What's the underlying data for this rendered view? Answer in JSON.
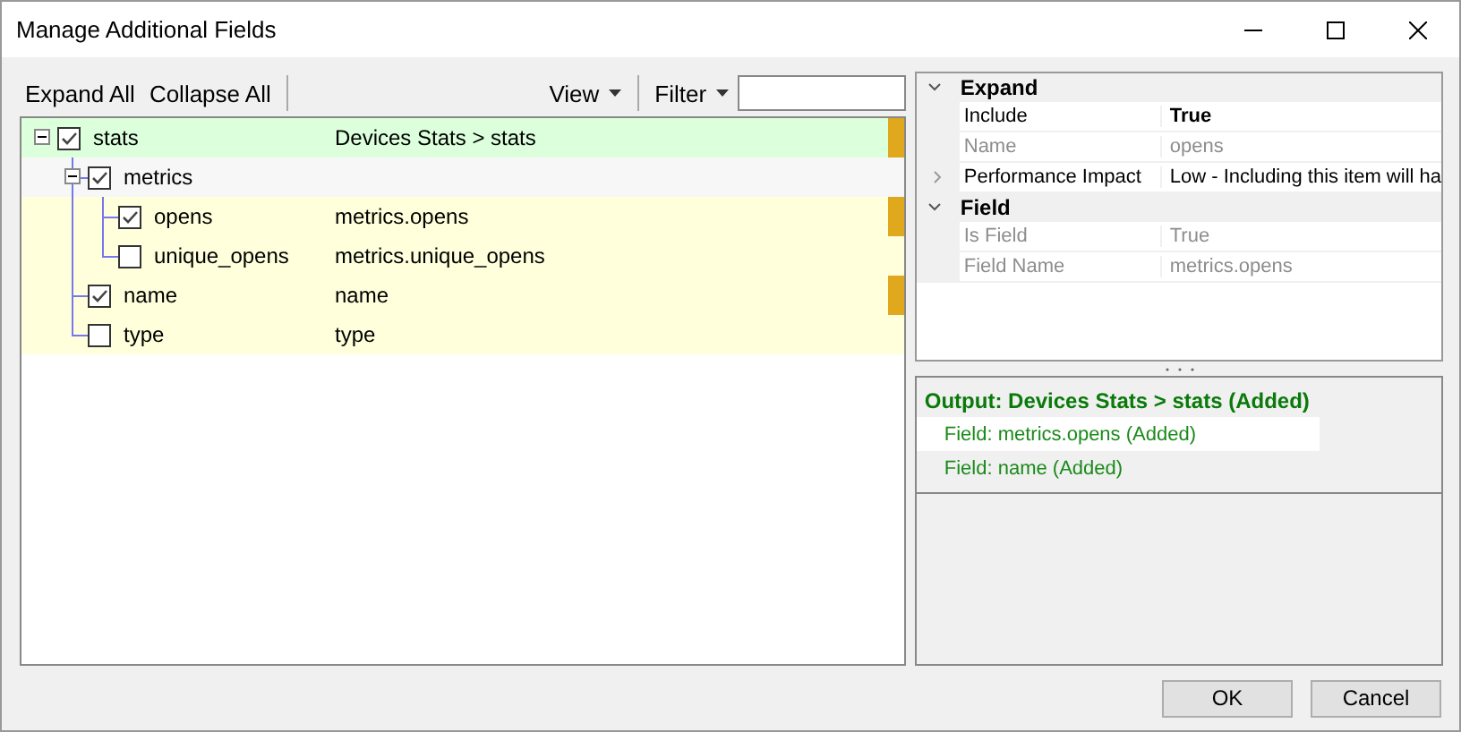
{
  "window": {
    "title": "Manage Additional Fields"
  },
  "toolbar": {
    "left_buttons": [
      "Expand All",
      "Collapse All"
    ],
    "view_menu": "View",
    "filter_menu": "Filter"
  },
  "tree": [
    {
      "label": "stats",
      "value": "Devices Stats > stats",
      "checked": true,
      "expanded": true,
      "marked": true,
      "color": "#dcffdc",
      "children": [
        {
          "label": "metrics",
          "checked": true,
          "expanded": true,
          "marked": false,
          "color": "#f7f7f7",
          "children": [
            {
              "label": "opens",
              "value": "metrics.opens",
              "checked": true,
              "marked": true,
              "color": "#ffffdc"
            },
            {
              "label": "unique_opens",
              "value": "metrics.unique_opens",
              "checked": false,
              "marked": false,
              "color": "#ffffdc"
            }
          ]
        },
        {
          "label": "name",
          "value": "name",
          "checked": true,
          "marked": true,
          "color": "#ffffdc"
        },
        {
          "label": "type",
          "value": "type",
          "checked": false,
          "marked": false,
          "color": "#ffffdc"
        }
      ]
    }
  ],
  "properties": [
    {
      "category": "Expand",
      "expanded": true,
      "items": [
        {
          "name": "Include",
          "value": "True",
          "disabled": false,
          "modified": true
        },
        {
          "name": "Name",
          "value": "opens",
          "disabled": true,
          "modified": false
        },
        {
          "name": "Performance Impact",
          "value": "Low - Including this item will ha",
          "disabled": false,
          "modified": false,
          "expanded": false
        }
      ]
    },
    {
      "category": "Field",
      "expanded": true,
      "items": [
        {
          "name": "Is Field",
          "value": "True",
          "disabled": true,
          "modified": false
        },
        {
          "name": "Field Name",
          "value": "metrics.opens",
          "disabled": true,
          "modified": false
        }
      ]
    }
  ],
  "output": {
    "heading": "Output: Devices Stats > stats (Added)",
    "items": [
      {
        "text": "Field: metrics.opens (Added)",
        "selected": true
      },
      {
        "text": "Field: name (Added)",
        "selected": false
      }
    ]
  },
  "buttons": [
    "OK",
    "Cancel"
  ]
}
